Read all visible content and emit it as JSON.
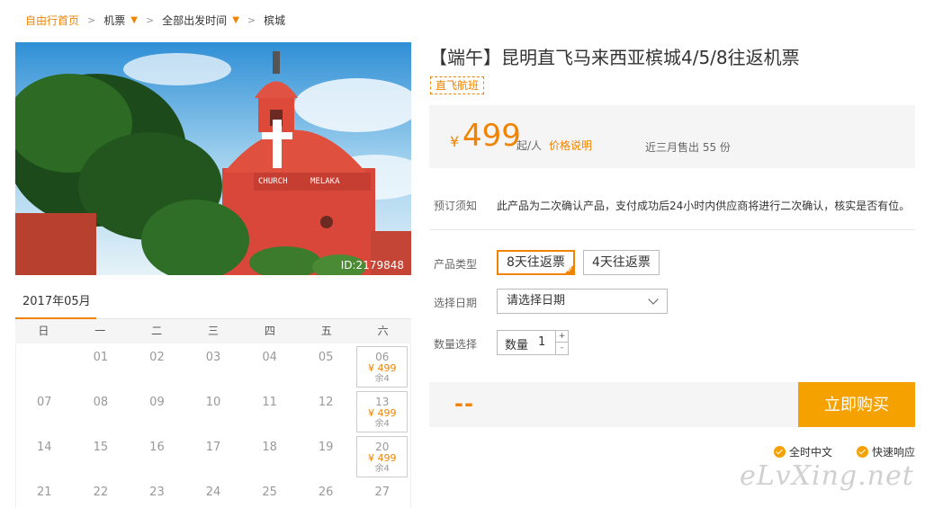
{
  "breadcrumb": {
    "home": "自由行首页",
    "items": [
      "机票",
      "全部出发时间",
      "槟城"
    ]
  },
  "hero": {
    "image_id": "ID:2179848",
    "sign_left": "CHURCH",
    "sign_right": "MELAKA"
  },
  "calendar": {
    "month": "2017年05月",
    "weekdays": [
      "日",
      "一",
      "二",
      "三",
      "四",
      "五",
      "六"
    ],
    "rows": [
      [
        "",
        "01",
        "02",
        "03",
        "04",
        "05",
        "06"
      ],
      [
        "07",
        "08",
        "09",
        "10",
        "11",
        "12",
        "13"
      ],
      [
        "14",
        "15",
        "16",
        "17",
        "18",
        "19",
        "20"
      ],
      [
        "21",
        "22",
        "23",
        "24",
        "25",
        "26",
        "27"
      ]
    ],
    "saturday_price": "¥ 499",
    "saturday_remain": "余4"
  },
  "product": {
    "title": "【端午】昆明直飞马来西亚槟城4/5/8往返机票",
    "tag": "直飞航班",
    "price": {
      "symbol": "¥",
      "amount": "499",
      "unit": "起/人",
      "link": "价格说明",
      "sold": "近三月售出 55 份"
    },
    "notice_label": "预订须知",
    "notice_text": "此产品为二次确认产品，支付成功后24小时内供应商将进行二次确认，核实是否有位。",
    "type_label": "产品类型",
    "types": [
      "8天往返票",
      "4天往返票"
    ],
    "date_label": "选择日期",
    "date_placeholder": "请选择日期",
    "qty_label": "数量选择",
    "qty_inner_label": "数量",
    "qty_value": "1",
    "qty_plus": "+",
    "qty_minus": "-",
    "total": "--",
    "buy_label": "立即购买",
    "services": [
      "全时中文",
      "快速响应"
    ]
  },
  "watermark": "eLvXing.net",
  "colors": {
    "accent": "#f08300",
    "buy": "#f5a100"
  }
}
